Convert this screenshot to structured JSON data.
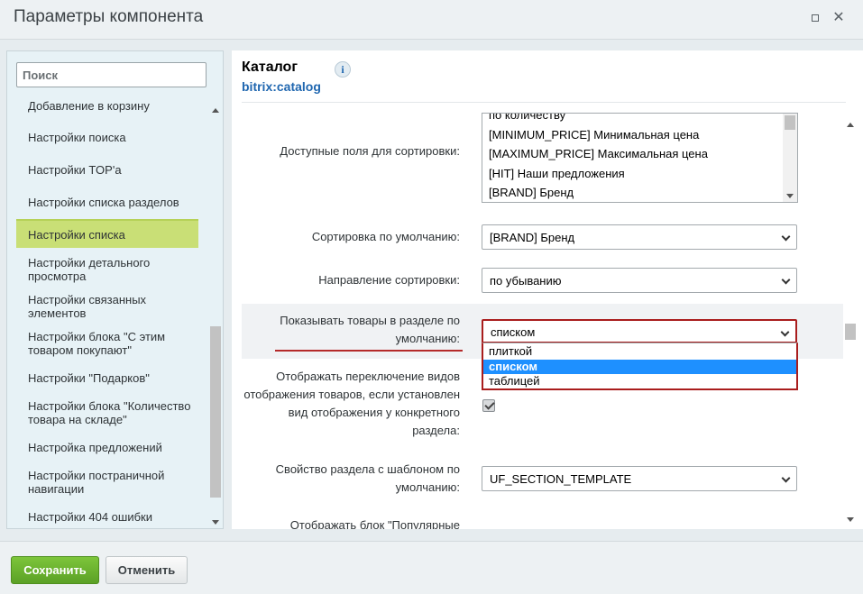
{
  "window": {
    "title": "Параметры компонента"
  },
  "sidebar": {
    "search_placeholder": "Поиск",
    "items": [
      {
        "label": "Добавление в корзину"
      },
      {
        "label": "Настройки поиска"
      },
      {
        "label": "Настройки TOP'а"
      },
      {
        "label": "Настройки списка разделов"
      },
      {
        "label": "Настройки списка",
        "active": true
      },
      {
        "label": "Настройки детального просмотра"
      },
      {
        "label": "Настройки связанных элементов"
      },
      {
        "label": "Настройки блока \"С этим товаром покупают\""
      },
      {
        "label": "Настройки \"Подарков\""
      },
      {
        "label": "Настройки блока \"Количество товара на складе\""
      },
      {
        "label": "Настройка предложений"
      },
      {
        "label": "Настройки постраничной навигации"
      },
      {
        "label": "Настройки 404 ошибки"
      }
    ]
  },
  "component": {
    "title": "Каталог",
    "id": "bitrix:catalog",
    "info_icon": "i"
  },
  "fields": {
    "sort_fields": {
      "label": "Доступные поля для сортировки:",
      "options": [
        "по количеству",
        "[MINIMUM_PRICE] Минимальная цена",
        "[MAXIMUM_PRICE] Максимальная цена",
        "[HIT] Наши предложения",
        "[BRAND] Бренд"
      ]
    },
    "default_sort": {
      "label": "Сортировка по умолчанию:",
      "value": "[BRAND] Бренд"
    },
    "sort_direction": {
      "label": "Направление сортировки:",
      "value": "по убыванию"
    },
    "default_view": {
      "label_line1": "Показывать товары в разделе по",
      "label_line2": "умолчанию:",
      "value": "списком",
      "options": [
        "плиткой",
        "списком",
        "таблицей"
      ],
      "selected_index": 1
    },
    "view_switch": {
      "label_line1": "Отображать переключение видов",
      "label_line2": "отображения товаров, если установлен",
      "label_line3": "вид отображения у конкретного",
      "label_line4": "раздела:",
      "checked": true
    },
    "section_template": {
      "label_line1": "Свойство раздела с шаблоном по",
      "label_line2": "умолчанию:",
      "value": "UF_SECTION_TEMPLATE"
    },
    "popular_block": {
      "label": "Отображать блок \"Популярные"
    }
  },
  "footer": {
    "save_label": "Сохранить",
    "cancel_label": "Отменить"
  },
  "colors": {
    "accent_green": "#5ba126",
    "active_item": "#c9df76",
    "link_blue": "#2067b0",
    "highlight_red": "#a91d1d",
    "option_selected": "#1e90ff"
  }
}
